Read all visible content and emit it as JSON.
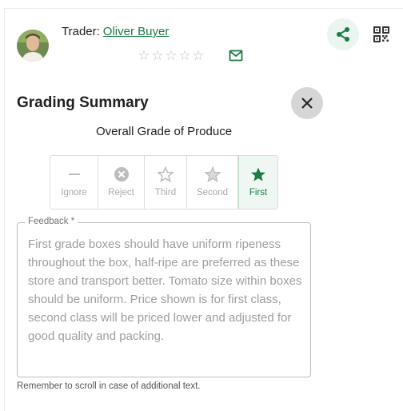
{
  "trader": {
    "label": "Trader:",
    "name": "Oliver Buyer",
    "rating_stars": "☆☆☆☆☆",
    "accent": "#1b7a46"
  },
  "icons": {
    "avatar": "avatar",
    "mail": "mail-icon",
    "share": "share-icon",
    "qr": "qr-code-icon",
    "close": "close-icon"
  },
  "dialog": {
    "title": "Grading Summary",
    "subtitle": "Overall Grade of Produce"
  },
  "grades": [
    {
      "label": "Ignore",
      "icon": "minus-icon",
      "selected": false
    },
    {
      "label": "Reject",
      "icon": "x-circle-icon",
      "selected": false
    },
    {
      "label": "Third",
      "icon": "star-outline-icon",
      "selected": false
    },
    {
      "label": "Second",
      "icon": "star-half-icon",
      "selected": false
    },
    {
      "label": "First",
      "icon": "star-filled-icon",
      "selected": true
    }
  ],
  "feedback": {
    "label": "Feedback *",
    "value": "First grade boxes should have uniform ripeness throughout the box, half-ripe are preferred as these store and transport better. Tomato size within boxes should be uniform. Price shown is for first class, second class will be priced lower and adjusted for good quality and packing.",
    "hint": "Remember to scroll in case of additional text."
  }
}
